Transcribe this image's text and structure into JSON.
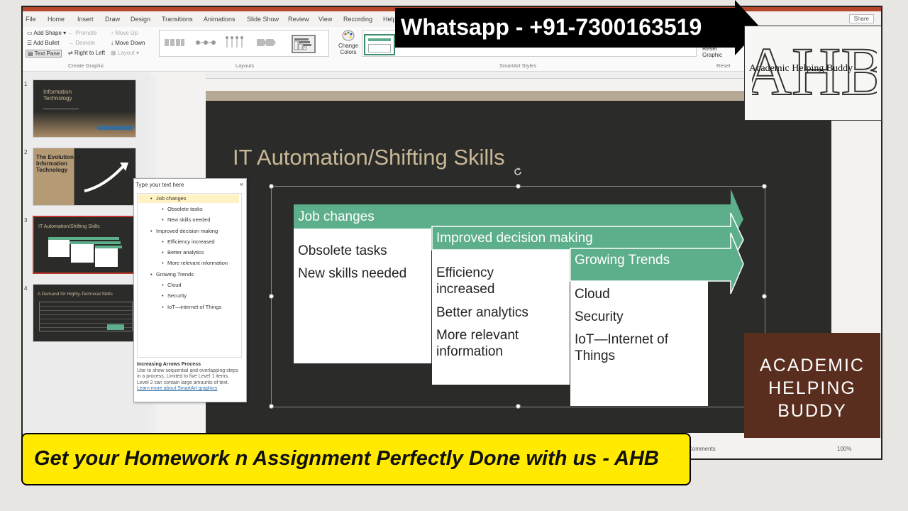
{
  "menu": {
    "items": [
      "File",
      "Home",
      "Insert",
      "Draw",
      "Design",
      "Transitions",
      "Animations",
      "Slide Show",
      "Review",
      "View",
      "Recording",
      "Help"
    ],
    "share": "Share"
  },
  "ribbon": {
    "create_graphic": {
      "add_shape": "Add Shape",
      "add_bullet": "Add Bullet",
      "text_pane": "Text Pane",
      "promote": "Promote",
      "demote": "Demote",
      "right_to_left": "Right to Left",
      "move_up": "Move Up",
      "move_down": "Move Down",
      "layout": "Layout",
      "group_label": "Create Graphic"
    },
    "layouts_label": "Layouts",
    "change_colors": "Change Colors",
    "smartart_styles_label": "SmartArt Styles",
    "reset_graphic": "Reset Graphic",
    "reset_label": "Reset"
  },
  "slides": [
    {
      "num": "1",
      "title": "Information Technology"
    },
    {
      "num": "2",
      "title": "The Evolution of Information Technology"
    },
    {
      "num": "3",
      "title": "IT Automation/Shifting Skills"
    },
    {
      "num": "4",
      "title": "A Demand for Highly-Technical Skills"
    }
  ],
  "text_pane": {
    "header": "Type your text here",
    "close": "×",
    "items": [
      {
        "level": 1,
        "text": "Job changes"
      },
      {
        "level": 2,
        "text": "Obsolete tasks"
      },
      {
        "level": 2,
        "text": "New skills needed"
      },
      {
        "level": 1,
        "text": "Improved decision making"
      },
      {
        "level": 2,
        "text": "Efficiency increased"
      },
      {
        "level": 2,
        "text": "Better analytics"
      },
      {
        "level": 2,
        "text": "More relevant information"
      },
      {
        "level": 1,
        "text": "Growing Trends"
      },
      {
        "level": 2,
        "text": "Cloud"
      },
      {
        "level": 2,
        "text": "Security"
      },
      {
        "level": 2,
        "text": "IoT—internet of Things"
      }
    ],
    "footer_title": "Increasing Arrows Process",
    "footer_desc": "Use to show sequential and overlapping steps in a process. Limited to five Level 1 items. Level 2 can contain large amounts of text.",
    "footer_link": "Learn more about SmartArt graphics"
  },
  "slide": {
    "title": "IT Automation/Shifting Skills",
    "arrows": [
      {
        "header": "Job changes",
        "lines": [
          "Obsolete tasks",
          "New skills needed"
        ]
      },
      {
        "header": "Improved decision making",
        "lines": [
          "Efficiency increased",
          "Better analytics",
          "More relevant information"
        ]
      },
      {
        "header": "Growing Trends",
        "lines": [
          "Cloud",
          "Security",
          "IoT—Internet of Things"
        ]
      }
    ]
  },
  "overlay": {
    "whatsapp": "Whatsapp - +91-7300163519",
    "logo_big": "AHB",
    "logo_small": "Academic  Helping  Buddy",
    "logo2_lines": [
      "ACADEMIC",
      "HELPING",
      "BUDDY"
    ],
    "banner": "Get your Homework n Assignment Perfectly Done with us  - AHB"
  },
  "status": {
    "zoom": "100%",
    "comments": "Comments"
  },
  "colors": {
    "accent_green": "#5dae8b",
    "slide_bg": "#2b2b29",
    "title_gold": "#c9b896",
    "banner_yellow": "#ffea00",
    "ppt_red": "#b7472a"
  }
}
